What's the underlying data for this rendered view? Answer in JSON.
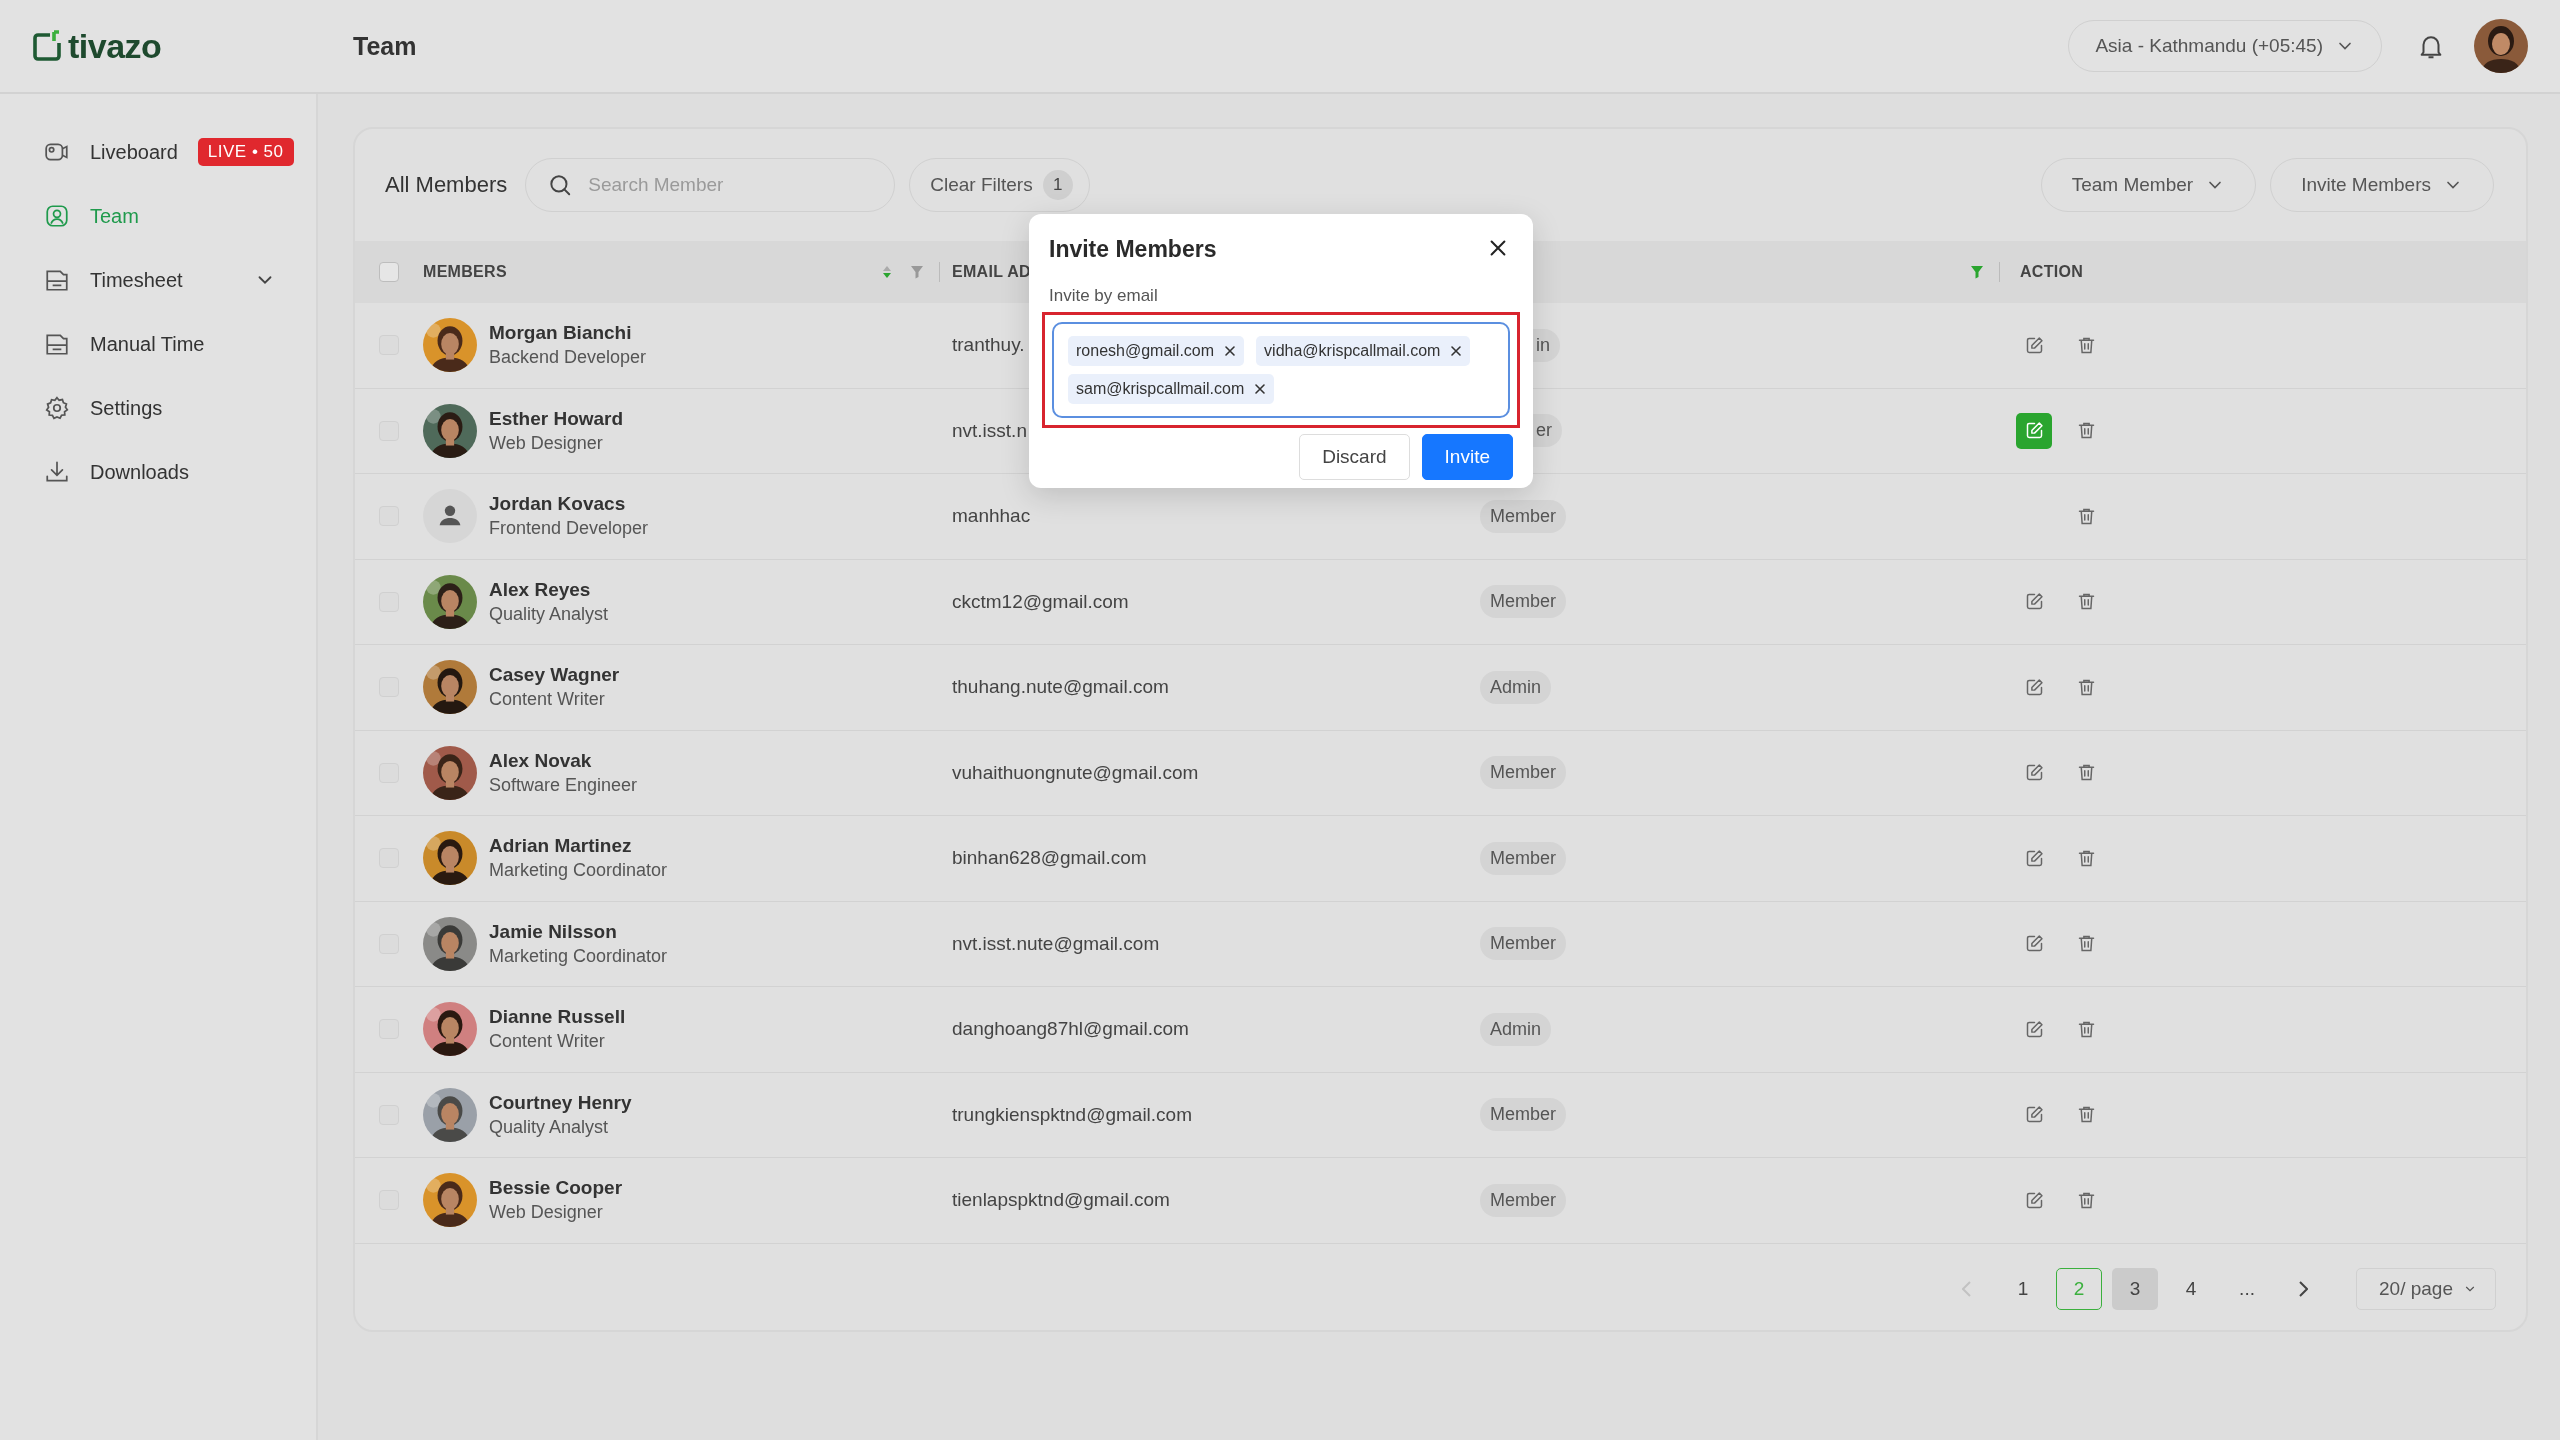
{
  "brand": {
    "name": "tivazo"
  },
  "topbar": {
    "title": "Team",
    "timezone": "Asia - Kathmandu (+05:45)"
  },
  "sidebar": {
    "items": [
      {
        "label": "Liveboard",
        "selected": false,
        "badge": "LIVE • 50"
      },
      {
        "label": "Team",
        "selected": true
      },
      {
        "label": "Timesheet",
        "selected": false,
        "expanded": false
      },
      {
        "label": "Manual Time",
        "selected": false
      },
      {
        "label": "Settings",
        "selected": false
      },
      {
        "label": "Downloads",
        "selected": false
      }
    ]
  },
  "toolbar": {
    "title": "All Members",
    "search": {
      "placeholder": "Search Member"
    },
    "clear_filters": {
      "label": "Clear Filters",
      "count": "1"
    },
    "dropdowns": [
      "Team Member",
      "Invite Members"
    ]
  },
  "table": {
    "all_checked": false,
    "columns": [
      {
        "label": "MEMBERS",
        "filtered": false
      },
      {
        "label": "EMAIL AD"
      },
      {
        "filtered": true
      },
      {
        "label": "ACTION"
      }
    ],
    "rows": [
      {
        "name": "Morgan Bianchi",
        "title": "Backend Developer",
        "email": "tranthuy.",
        "role": "in",
        "covered": true,
        "checked": false,
        "editable": true,
        "edit_active": false
      },
      {
        "name": "Esther Howard",
        "title": "Web Designer",
        "email": "nvt.isst.n",
        "role": "er",
        "covered": true,
        "checked": false,
        "editable": true,
        "edit_active": true
      },
      {
        "name": "Jordan Kovacs",
        "title": "Frontend Developer",
        "avatar": {
          "kind": "placeholder"
        },
        "email": "manhhac",
        "role": "Member",
        "covered": false,
        "checked": false,
        "editable": false
      },
      {
        "name": "Alex Reyes",
        "title": "Quality Analyst",
        "email": "ckctm12@gmail.com",
        "role": "Member",
        "covered": false,
        "checked": false,
        "editable": true,
        "edit_active": false
      },
      {
        "name": "Casey Wagner",
        "title": "Content Writer",
        "email": "thuhang.nute@gmail.com",
        "role": "Admin",
        "covered": false,
        "checked": false,
        "editable": true,
        "edit_active": false
      },
      {
        "name": "Alex Novak",
        "title": "Software Engineer",
        "email": "vuhaithuongnute@gmail.com",
        "role": "Member",
        "covered": false,
        "checked": false,
        "editable": true,
        "edit_active": false
      },
      {
        "name": "Adrian Martinez",
        "title": "Marketing Coordinator",
        "email": "binhan628@gmail.com",
        "role": "Member",
        "covered": false,
        "checked": false,
        "editable": true,
        "edit_active": false
      },
      {
        "name": "Jamie Nilsson",
        "title": "Marketing Coordinator",
        "email": "nvt.isst.nute@gmail.com",
        "role": "Member",
        "covered": false,
        "checked": false,
        "editable": true,
        "edit_active": false
      },
      {
        "name": "Dianne Russell",
        "title": "Content Writer",
        "email": "danghoang87hl@gmail.com",
        "role": "Admin",
        "covered": false,
        "checked": false,
        "editable": true,
        "edit_active": false
      },
      {
        "name": "Courtney Henry",
        "title": "Quality Analyst",
        "email": "trungkienspktnd@gmail.com",
        "role": "Member",
        "covered": false,
        "checked": false,
        "editable": true,
        "edit_active": false
      },
      {
        "name": "Bessie Cooper",
        "title": "Web Designer",
        "email": "tienlapspktnd@gmail.com",
        "role": "Member",
        "covered": false,
        "checked": false,
        "editable": true,
        "edit_active": false
      }
    ]
  },
  "pagination": {
    "prev_disabled": true,
    "pages": [
      {
        "label": "1",
        "selected": false,
        "hovered": false
      },
      {
        "label": "2",
        "selected": true,
        "hovered": false
      },
      {
        "label": "3",
        "selected": false,
        "hovered": true
      },
      {
        "label": "4",
        "selected": false,
        "hovered": false
      },
      {
        "label": "...",
        "selected": false,
        "hovered": false
      }
    ],
    "page_size": "20/ page"
  },
  "modal": {
    "title": "Invite Members",
    "field_label": "Invite by email",
    "highlighted": true,
    "tags": [
      "ronesh@gmail.com",
      "vidha@krispcallmail.com",
      "sam@krispcallmail.com"
    ],
    "buttons": [
      {
        "label": "Discard",
        "kind": "secondary"
      },
      {
        "label": "Invite",
        "kind": "primary"
      }
    ]
  }
}
